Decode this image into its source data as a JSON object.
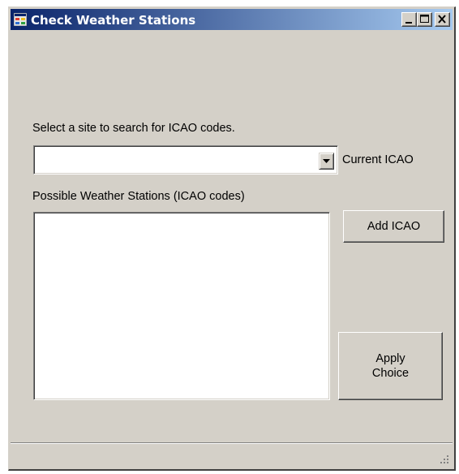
{
  "window": {
    "title": "Check Weather Stations",
    "controls": {
      "minimize_icon": "minimize-icon",
      "maximize_icon": "maximize-icon",
      "close_icon": "close-icon"
    }
  },
  "form": {
    "site_label": "Select a site to search for ICAO codes.",
    "site_select_value": "",
    "current_icao_label": "Current ICAO",
    "stations_label": "Possible Weather Stations (ICAO codes)",
    "stations_list": [],
    "add_button_label": "Add ICAO",
    "apply_button_line1": "Apply",
    "apply_button_line2": "Choice"
  },
  "colors": {
    "face": "#d4d0c8",
    "title_start": "#0a246a",
    "title_end": "#a6caf0"
  }
}
